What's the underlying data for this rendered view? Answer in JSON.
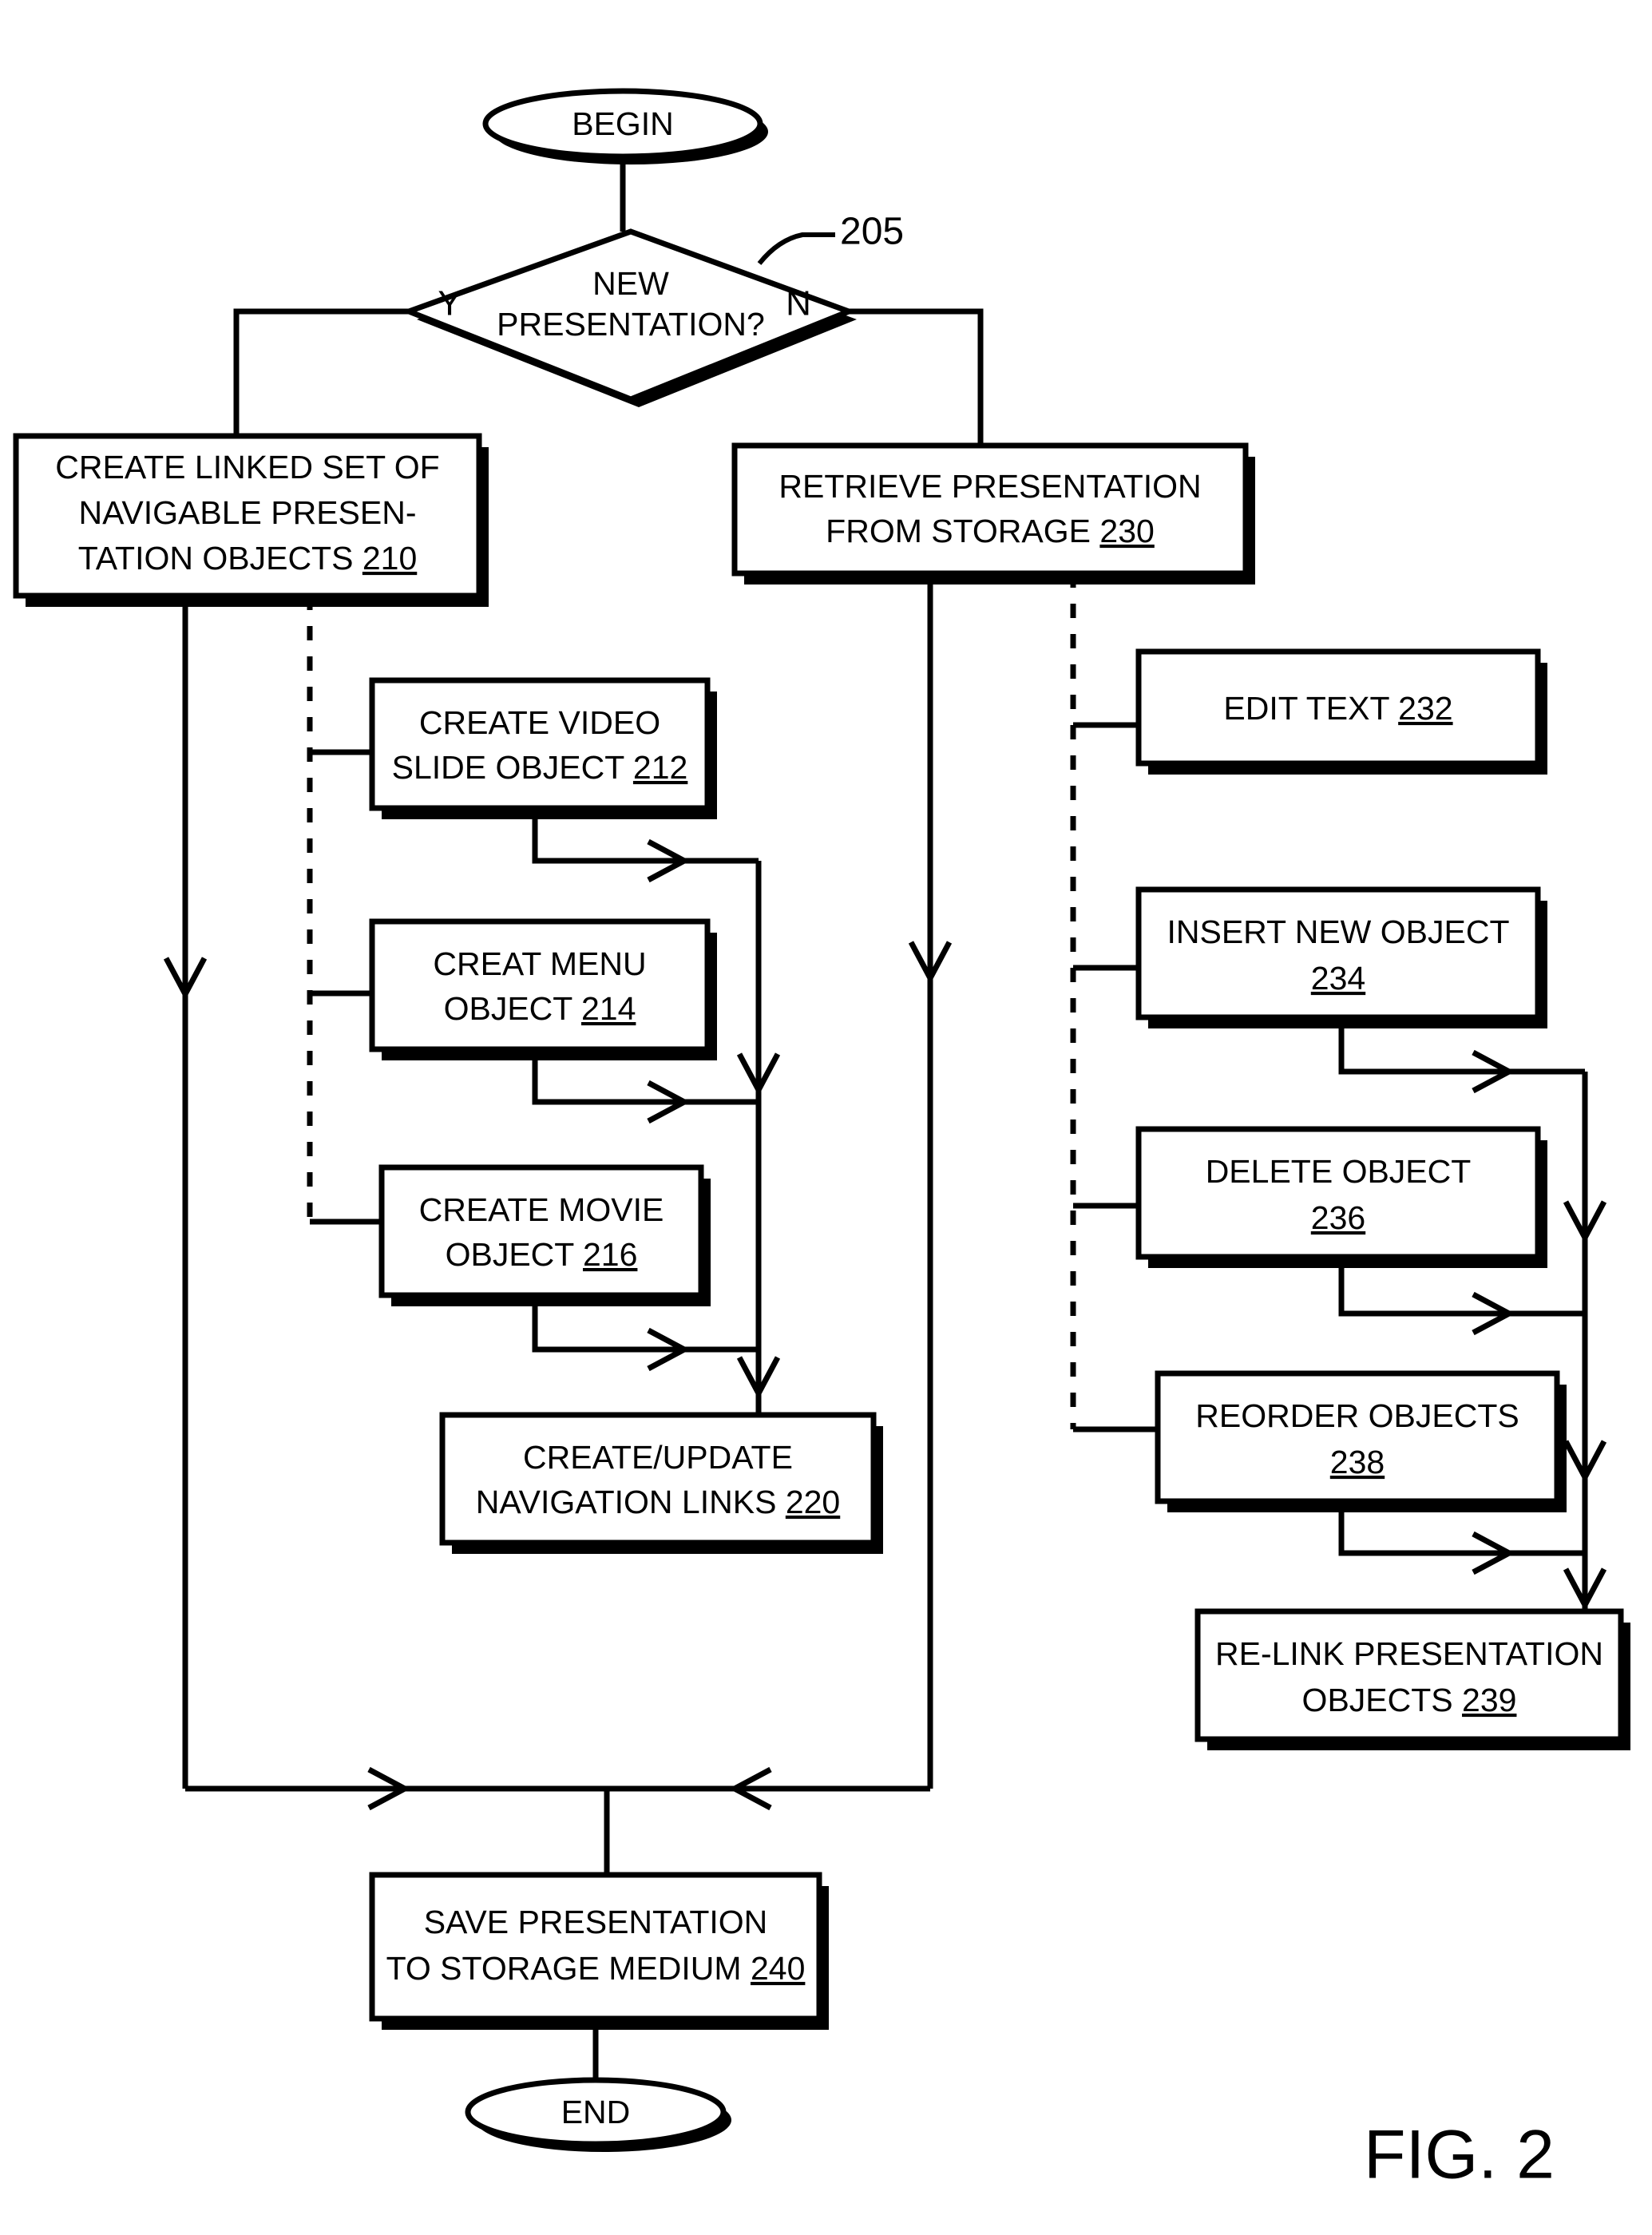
{
  "figure": {
    "label": "FIG. 2",
    "reference_callout": "205"
  },
  "terminators": {
    "begin": "BEGIN",
    "end": "END"
  },
  "decision": {
    "line1": "NEW",
    "line2": "PRESENTATION?",
    "yes_label": "Y",
    "no_label": "N",
    "ref": "205"
  },
  "nodes": {
    "n210": {
      "line1": "CREATE LINKED SET OF",
      "line2": "NAVIGABLE PRESEN-",
      "line3_text": "TATION OBJECTS ",
      "ref": "210"
    },
    "n230": {
      "line1": "RETRIEVE PRESENTATION",
      "line2_text": "FROM STORAGE ",
      "ref": "230"
    },
    "n212": {
      "line1": "CREATE VIDEO",
      "line2_text": "SLIDE OBJECT ",
      "ref": "212"
    },
    "n214": {
      "line1": "CREAT MENU",
      "line2_text": "OBJECT ",
      "ref": "214"
    },
    "n216": {
      "line1": "CREATE MOVIE",
      "line2_text": "OBJECT ",
      "ref": "216"
    },
    "n220": {
      "line1": "CREATE/UPDATE",
      "line2_text": "NAVIGATION LINKS ",
      "ref": "220"
    },
    "n232": {
      "line1_text": "EDIT TEXT ",
      "ref": "232"
    },
    "n234": {
      "line1": "INSERT NEW OBJECT",
      "ref": "234"
    },
    "n236": {
      "line1": "DELETE OBJECT",
      "ref": "236"
    },
    "n238": {
      "line1": "REORDER OBJECTS",
      "ref": "238"
    },
    "n239": {
      "line1": "RE-LINK PRESENTATION",
      "line2_text": "OBJECTS ",
      "ref": "239"
    },
    "n240": {
      "line1": "SAVE PRESENTATION",
      "line2_text": "TO STORAGE MEDIUM ",
      "ref": "240"
    }
  },
  "colors": {
    "ink": "#000000",
    "paper": "#ffffff"
  }
}
